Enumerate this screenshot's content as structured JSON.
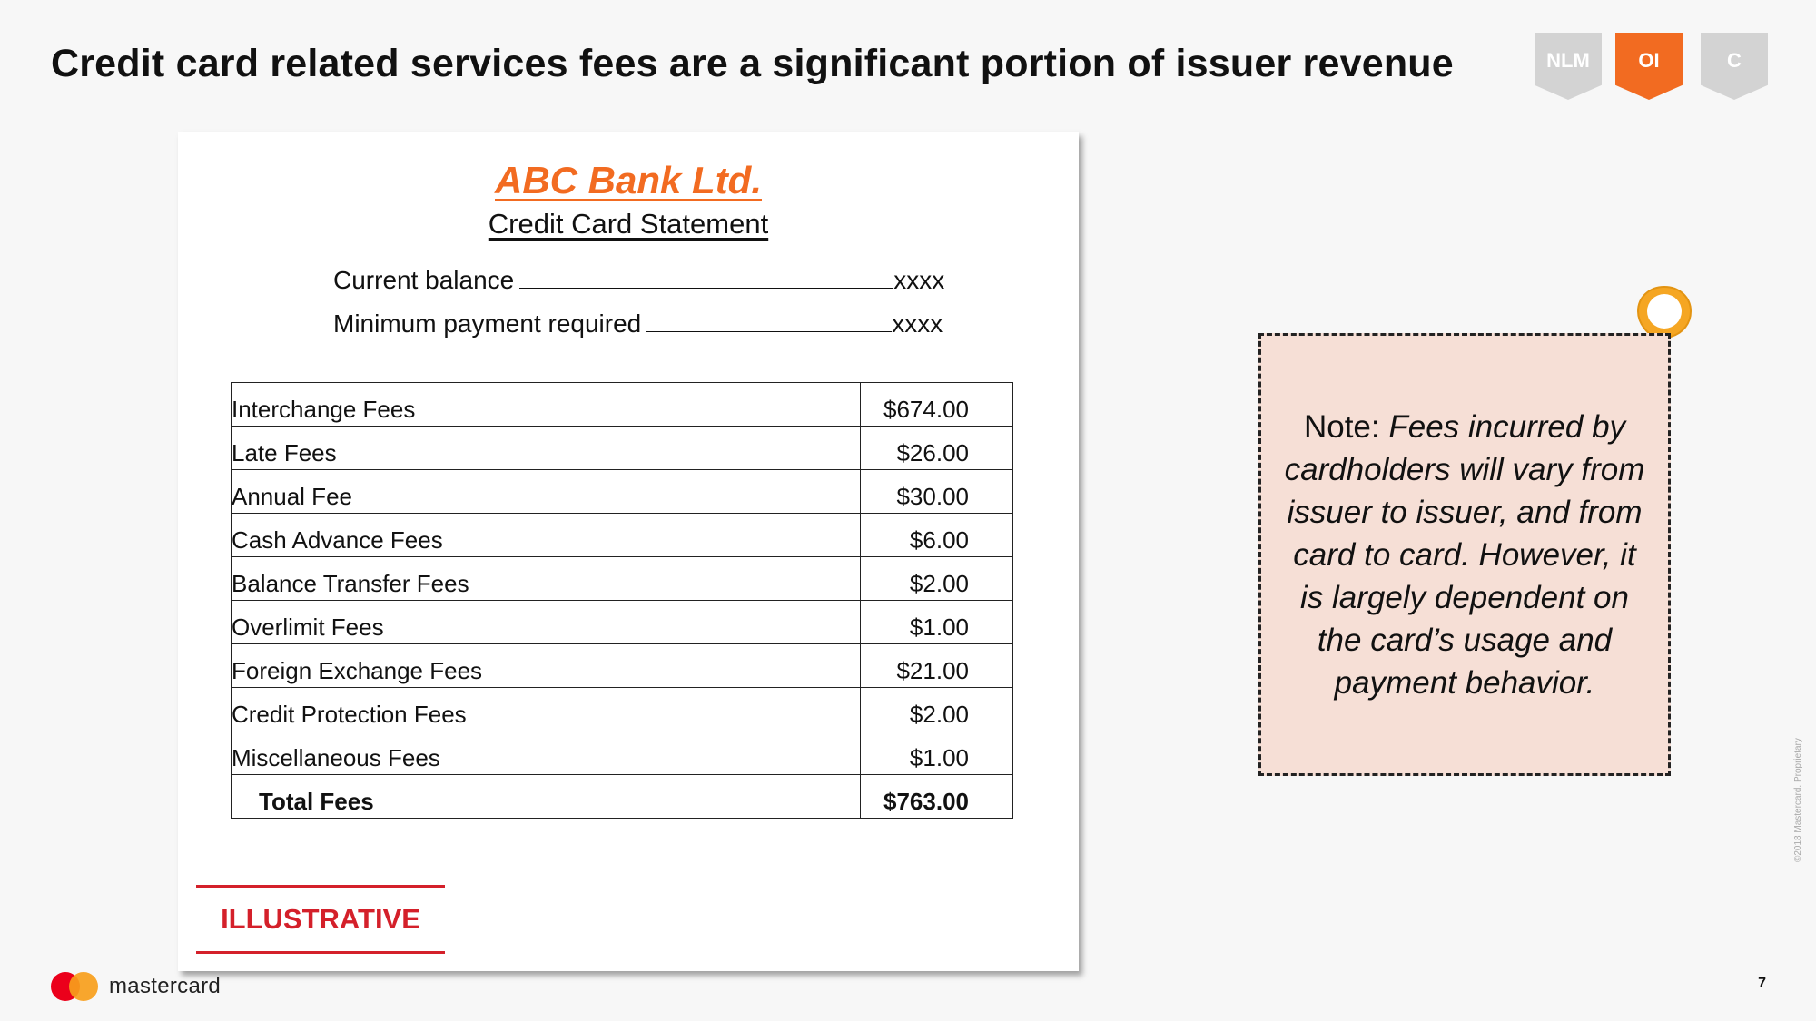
{
  "title": "Credit card related services fees are a significant portion of issuer revenue",
  "badges": [
    {
      "label": "NLM",
      "color": "#d3d3d3"
    },
    {
      "label": "OI",
      "color": "#f26b21"
    },
    {
      "label": "C",
      "color": "#d3d3d3"
    }
  ],
  "statement": {
    "bank_name": "ABC Bank Ltd.",
    "title": "Credit Card Statement",
    "current_balance_label": "Current balance",
    "current_balance_value": "xxxx",
    "minimum_payment_label": "Minimum payment required",
    "minimum_payment_value": "xxxx",
    "fees": [
      {
        "label": "Interchange Fees",
        "amount": "$674.00"
      },
      {
        "label": "Late Fees",
        "amount": "$26.00"
      },
      {
        "label": "Annual Fee",
        "amount": "$30.00"
      },
      {
        "label": "Cash Advance Fees",
        "amount": "$6.00"
      },
      {
        "label": "Balance Transfer Fees",
        "amount": "$2.00"
      },
      {
        "label": "Overlimit Fees",
        "amount": "$1.00"
      },
      {
        "label": "Foreign Exchange Fees",
        "amount": "$21.00"
      },
      {
        "label": "Credit Protection Fees",
        "amount": "$2.00"
      },
      {
        "label": "Miscellaneous Fees",
        "amount": "$1.00"
      }
    ],
    "total_label": "Total Fees",
    "total_amount": "$763.00",
    "illustrative": "ILLUSTRATIVE"
  },
  "note": {
    "prefix": "Note: ",
    "body": "Fees incurred by cardholders will vary from issuer to issuer, and from card to card. However, it is largely dependent on the card’s usage and payment behavior."
  },
  "footer": {
    "brand": "mastercard",
    "page_number": "7",
    "copyright": "©2018 Mastercard. Proprietary"
  },
  "colors": {
    "accent": "#f26b21",
    "illustrative_red": "#d4202a",
    "note_background": "#f6dfd6"
  }
}
